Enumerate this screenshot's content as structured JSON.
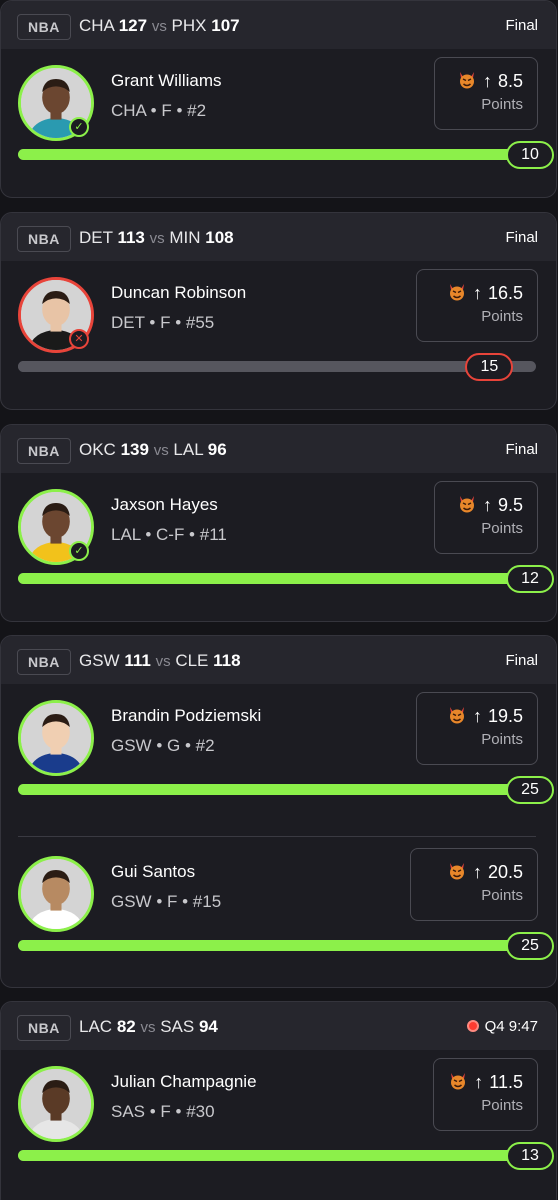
{
  "colors": {
    "win": "#8cf04a",
    "loss": "#e8443a",
    "track": "#56565e",
    "live": "#ff3b30"
  },
  "games": [
    {
      "league": "NBA",
      "home_team": "CHA",
      "home_score": "127",
      "vs": "vs",
      "away_team": "PHX",
      "away_score": "107",
      "status": "Final",
      "live": false,
      "picks": [
        {
          "name": "Grant Williams",
          "meta": "CHA • F • #2",
          "line": "8.5",
          "stat": "Points",
          "actual": "10",
          "progress": 1.0,
          "result": "hit",
          "icon": "check-icon"
        }
      ]
    },
    {
      "league": "NBA",
      "home_team": "DET",
      "home_score": "113",
      "vs": "vs",
      "away_team": "MIN",
      "away_score": "108",
      "status": "Final",
      "live": false,
      "picks": [
        {
          "name": "Duncan Robinson",
          "meta": "DET • F • #55",
          "line": "16.5",
          "stat": "Points",
          "actual": "15",
          "progress": 0.91,
          "result": "miss",
          "icon": "x-icon"
        }
      ]
    },
    {
      "league": "NBA",
      "home_team": "OKC",
      "home_score": "139",
      "vs": "vs",
      "away_team": "LAL",
      "away_score": "96",
      "status": "Final",
      "live": false,
      "picks": [
        {
          "name": "Jaxson Hayes",
          "meta": "LAL • C-F • #11",
          "line": "9.5",
          "stat": "Points",
          "actual": "12",
          "progress": 1.0,
          "result": "hit",
          "icon": "check-icon"
        }
      ]
    },
    {
      "league": "NBA",
      "home_team": "GSW",
      "home_score": "111",
      "vs": "vs",
      "away_team": "CLE",
      "away_score": "118",
      "status": "Final",
      "live": false,
      "picks": [
        {
          "name": "Brandin Podziemski",
          "meta": "GSW • G • #2",
          "line": "19.5",
          "stat": "Points",
          "actual": "25",
          "progress": 1.0,
          "result": "hit",
          "icon": ""
        },
        {
          "name": "Gui Santos",
          "meta": "GSW • F • #15",
          "line": "20.5",
          "stat": "Points",
          "actual": "25",
          "progress": 1.0,
          "result": "hit",
          "icon": ""
        }
      ]
    },
    {
      "league": "NBA",
      "home_team": "LAC",
      "home_score": "82",
      "vs": "vs",
      "away_team": "SAS",
      "away_score": "94",
      "status": "Q4 9:47",
      "live": true,
      "picks": [
        {
          "name": "Julian Champagnie",
          "meta": "SAS • F • #30",
          "line": "11.5",
          "stat": "Points",
          "actual": "13",
          "progress": 1.0,
          "result": "hit",
          "icon": ""
        }
      ]
    }
  ]
}
